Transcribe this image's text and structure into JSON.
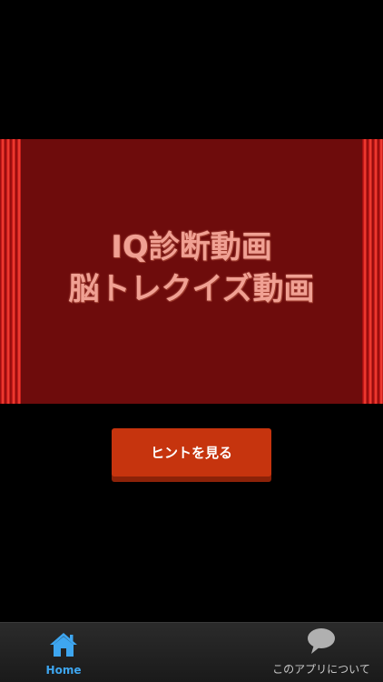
{
  "banner": {
    "title_line1": "IQ診断動画",
    "title_line2": "脳トレクイズ動画"
  },
  "hint_button": {
    "label": "ヒントを見る"
  },
  "tabbar": {
    "tabs": [
      {
        "label": "Home",
        "icon": "home-icon",
        "active": true
      },
      {
        "label": "このアプリについて",
        "icon": "speech-bubble-icon",
        "active": false
      }
    ]
  },
  "colors": {
    "stage": "#6e0c0c",
    "button": "#c6340e",
    "active_tab": "#3ea6f0"
  }
}
